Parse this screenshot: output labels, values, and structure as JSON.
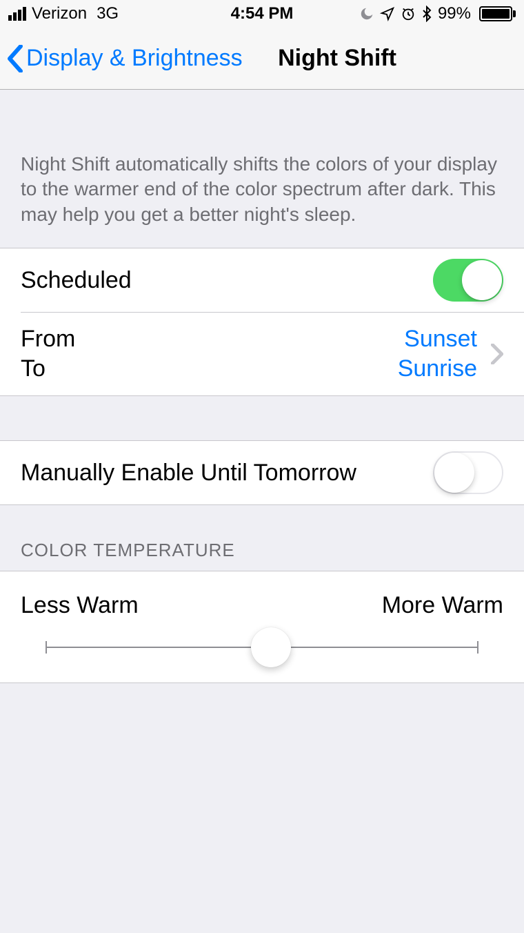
{
  "status_bar": {
    "carrier": "Verizon",
    "network": "3G",
    "time": "4:54 PM",
    "battery_percent": "99%"
  },
  "nav": {
    "back_label": "Display & Brightness",
    "title": "Night Shift"
  },
  "description": "Night Shift automatically shifts the colors of your display to the warmer end of the color spectrum after dark. This may help you get a better night's sleep.",
  "rows": {
    "scheduled": {
      "label": "Scheduled",
      "value": true
    },
    "schedule_range": {
      "from_label": "From",
      "to_label": "To",
      "from_value": "Sunset",
      "to_value": "Sunrise"
    },
    "manual": {
      "label": "Manually Enable Until Tomorrow",
      "value": false
    }
  },
  "color_temperature": {
    "header": "COLOR TEMPERATURE",
    "min_label": "Less Warm",
    "max_label": "More Warm",
    "value_percent": 52
  }
}
